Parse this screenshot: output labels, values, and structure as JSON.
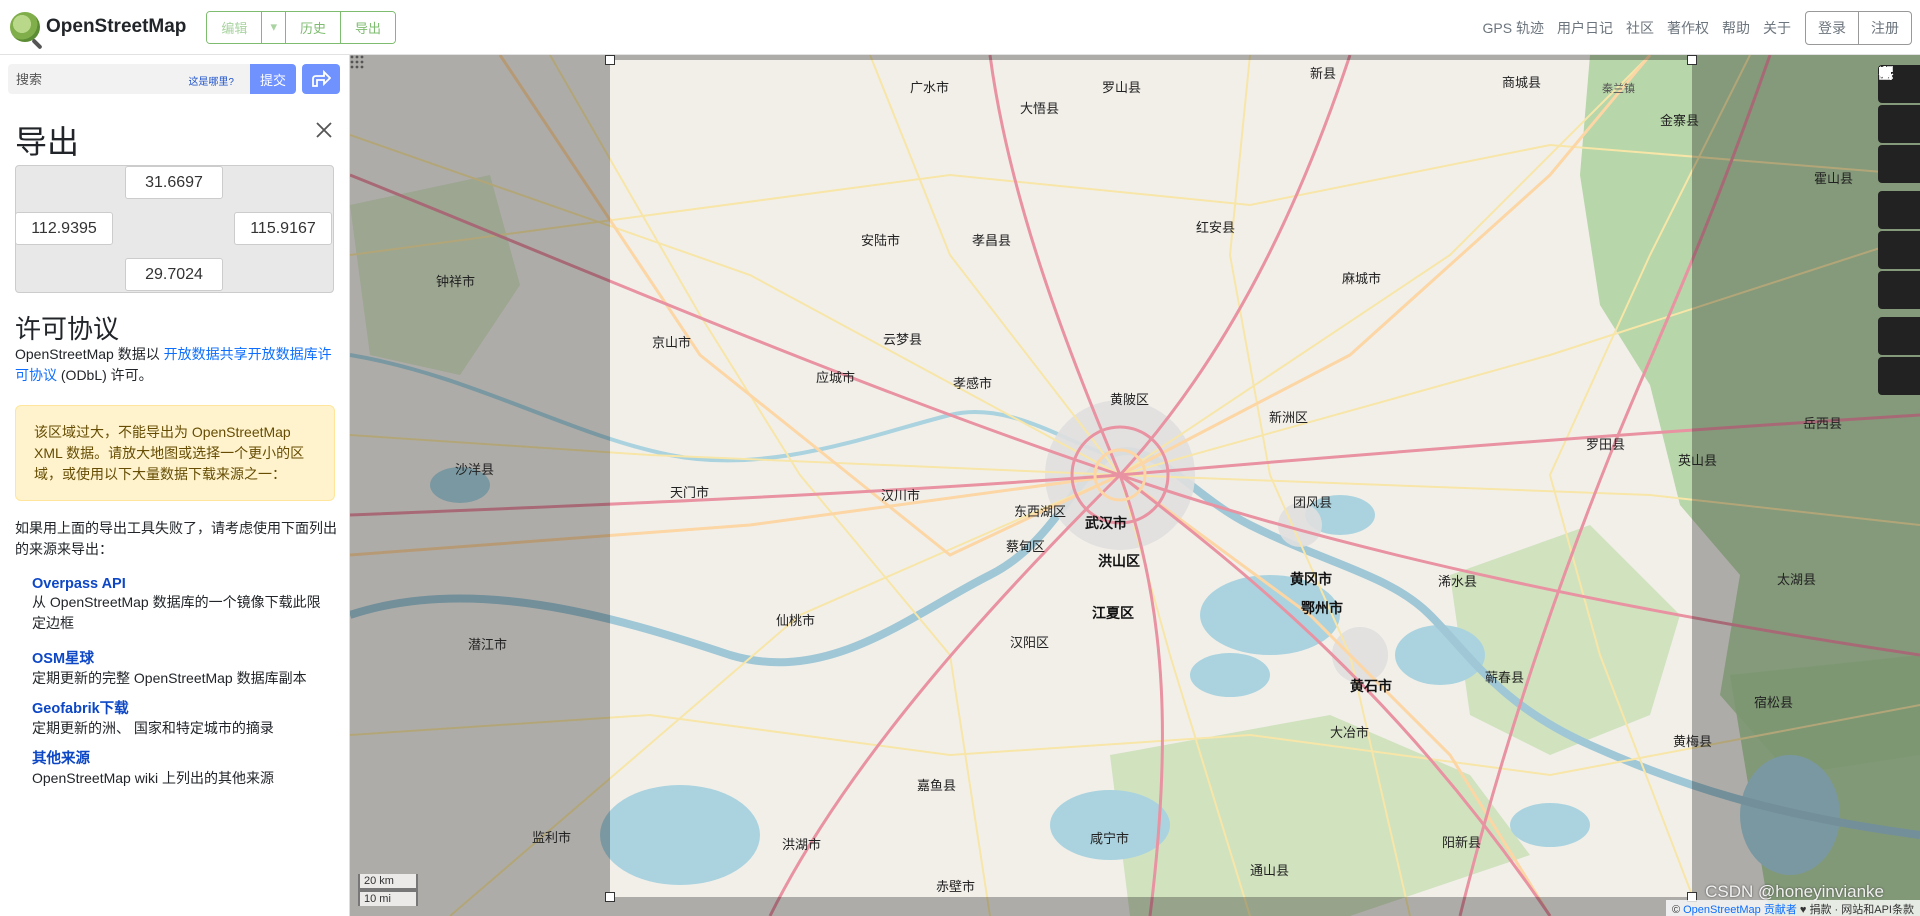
{
  "header": {
    "app_name": "OpenStreetMap",
    "edit_label": "编辑",
    "history_label": "历史",
    "export_label": "导出",
    "nav": [
      "GPS 轨迹",
      "用户日记",
      "社区",
      "著作权",
      "帮助",
      "关于"
    ],
    "login_label": "登录",
    "signup_label": "注册"
  },
  "search": {
    "placeholder": "搜索",
    "where_label": "这是哪里?",
    "submit_label": "提交"
  },
  "export_panel": {
    "title": "导出",
    "bbox": {
      "north": "31.6697",
      "west": "112.9395",
      "east": "115.9167",
      "south": "29.7024"
    },
    "license_title": "许可协议",
    "license_pre": "OpenStreetMap 数据以 ",
    "license_link": "开放数据共享开放数据库许可协议",
    "license_post": " (ODbL) 许可。",
    "warning": "该区域过大，不能导出为 OpenStreetMap XML 数据。请放大地图或选择一个更小的区域，或使用以下大量数据下载来源之一：",
    "fallback_text": "如果用上面的导出工具失败了，请考虑使用下面列出的来源来导出：",
    "sources": [
      {
        "title": "Overpass API",
        "desc": "从 OpenStreetMap 数据库的一个镜像下载此限定边框"
      },
      {
        "title": "OSM星球",
        "desc": "定期更新的完整 OpenStreetMap 数据库副本"
      },
      {
        "title": "Geofabrik下载",
        "desc": "定期更新的洲、 国家和特定城市的摘录"
      },
      {
        "title": "其他来源",
        "desc": "OpenStreetMap wiki 上列出的其他来源"
      }
    ]
  },
  "map": {
    "labels": {
      "wuhan": "武汉市",
      "hongshan": "洪山区",
      "jiangxia": "江夏区",
      "caidian": "蔡甸区",
      "dongxihu": "东西湖区",
      "hanyang": "汉阳区",
      "xiaogan": "孝感市",
      "huangpi": "黄陂区",
      "xinzhou": "新洲区",
      "huanggang": "黄冈市",
      "ezhou": "鄂州市",
      "huangshi": "黄石市",
      "xianning": "咸宁市",
      "tianmen": "天门市",
      "xiantao": "仙桃市",
      "hanchuan": "汉川市",
      "yingcheng": "应城市",
      "yunmeng": "云梦县",
      "anlu": "安陆市",
      "dawu": "大悟县",
      "hong_an": "红安县",
      "macheng": "麻城市",
      "tuanfeng": "团风县",
      "xishui": "浠水县",
      "qichun": "蕲春县",
      "daye": "大冶市",
      "jiayu": "嘉鱼县",
      "chibi": "赤壁市",
      "honghu": "洪湖市",
      "jianli": "监利市",
      "guangshui": "广水市",
      "xiaochang": "孝昌县",
      "jingshan": "京山市",
      "luotian": "罗田县",
      "yingshan": "英山县",
      "yangxin": "阳新县",
      "tongshan": "通山县",
      "huangmei": "黄梅县",
      "susong": "宿松县",
      "taihu": "太湖县",
      "yuexi": "岳西县",
      "jingzhou": "潜江市",
      "qianjiang": "沙洋县",
      "zhongxiang": "钟祥市",
      "hongan2": "新县",
      "shangcheng": "商城县",
      "lushan": "罗山县",
      "huoshan": "霍山县",
      "qinshi": "秦兰镇",
      "jinzhai": "金寨县"
    },
    "scale_km": "20 km",
    "scale_mi": "10 mi",
    "attribution_prefix": "© ",
    "attribution_link": "OpenStreetMap 贡献者",
    "attribution_suffix": " ♥ 捐款 · 网站和API条款",
    "watermark": "CSDN @honeyinvianke"
  },
  "controls": [
    "zoom-in",
    "zoom-out",
    "locate",
    "layers",
    "info",
    "share",
    "note",
    "query"
  ]
}
